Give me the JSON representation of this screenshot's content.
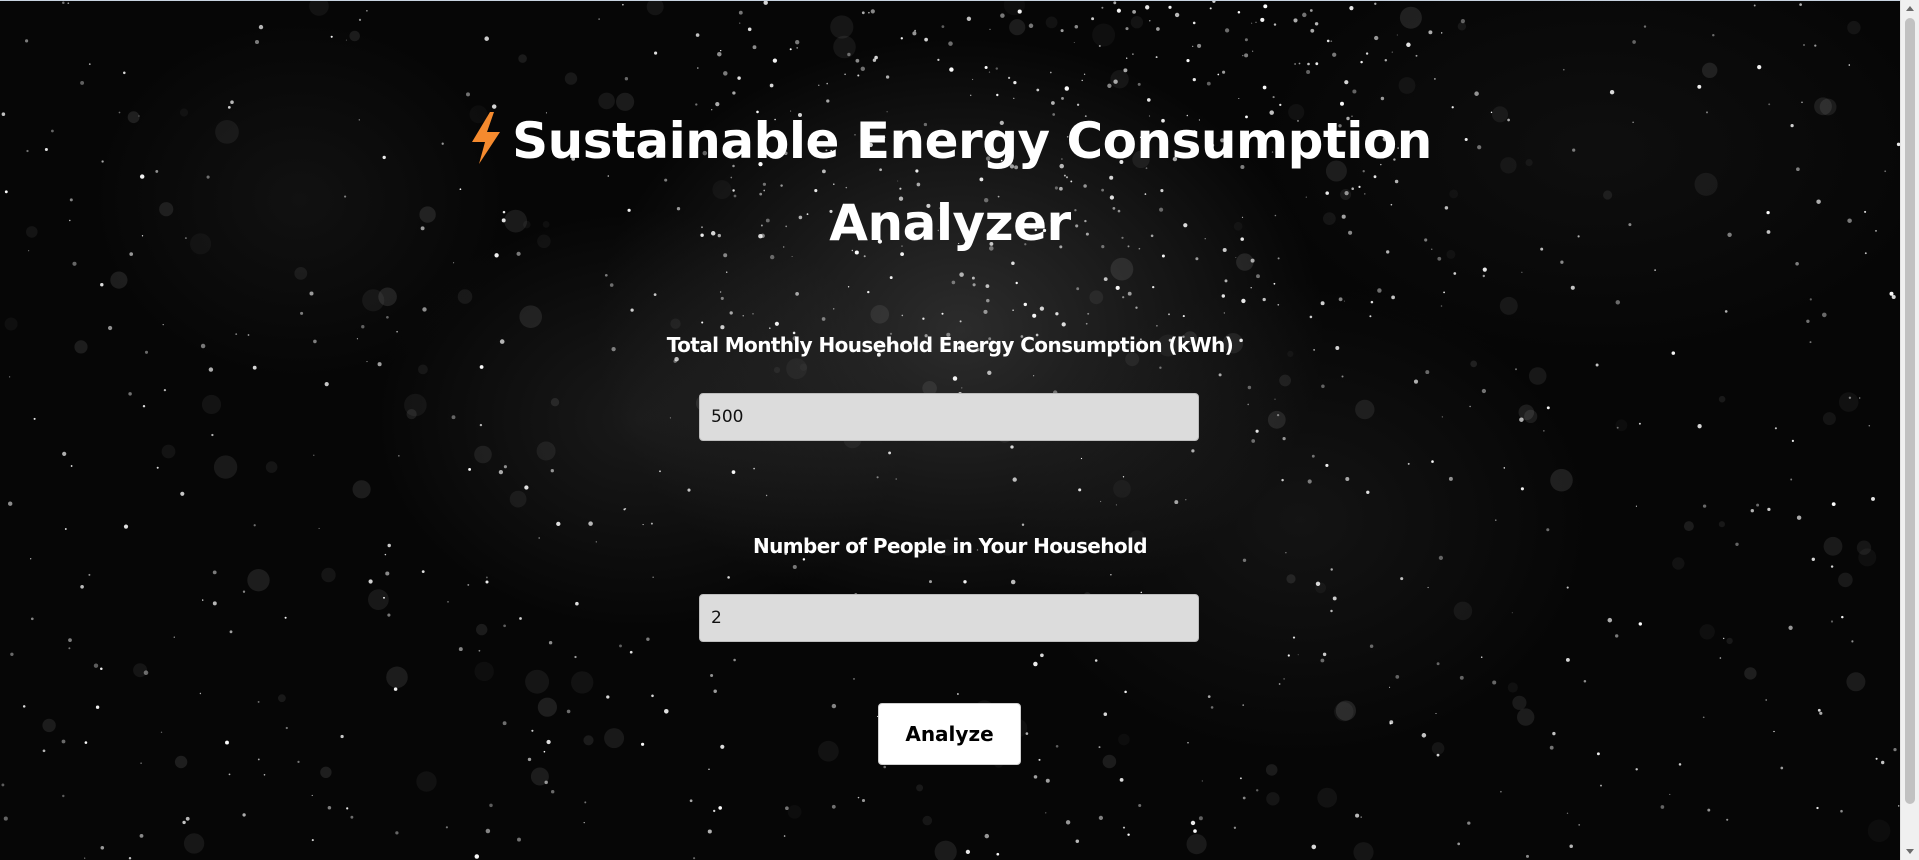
{
  "header": {
    "title": "Sustainable Energy Consumption Analyzer",
    "icon": "lightning-bolt-icon"
  },
  "form": {
    "energy_label": "Total Monthly Household Energy Consumption (kWh)",
    "energy_value": "500",
    "people_label": "Number of People in Your Household",
    "people_value": "2",
    "submit_label": "Analyze"
  },
  "colors": {
    "background": "#050505",
    "title_text": "#ffffff",
    "accent_bolt": "#f58a2e",
    "input_background": "#dcdcdc",
    "button_background": "#ffffff",
    "button_text": "#000000"
  }
}
